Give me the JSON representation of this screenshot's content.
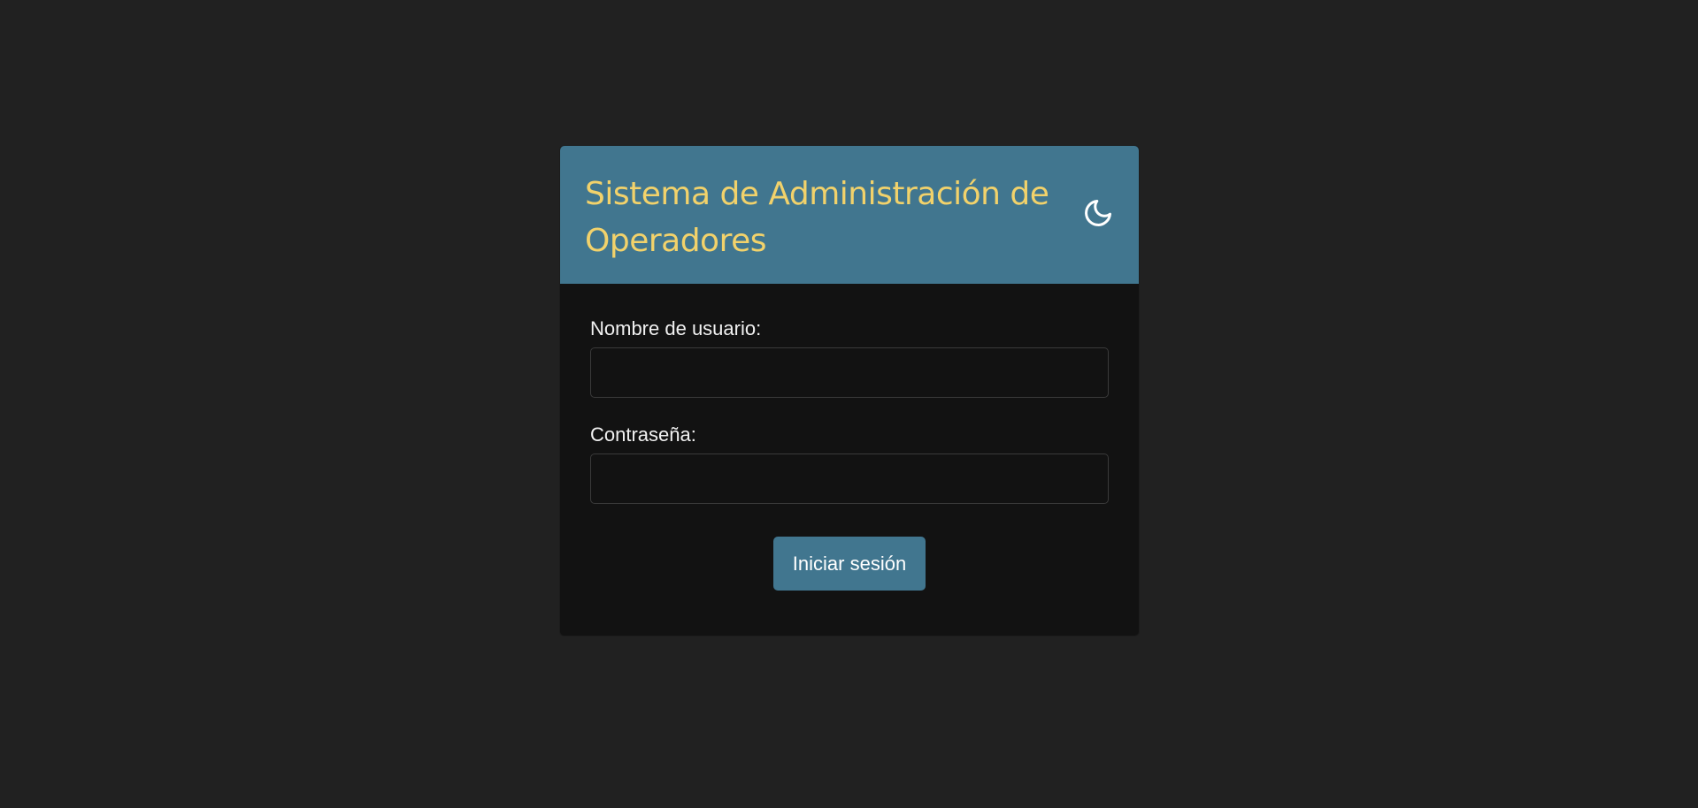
{
  "header": {
    "title": "Sistema de Administración de Operadores",
    "theme_icon": "moon-icon"
  },
  "form": {
    "username_label": "Nombre de usuario:",
    "username_value": "",
    "password_label": "Contraseña:",
    "password_value": "",
    "submit_label": "Iniciar sesión"
  },
  "colors": {
    "page_background": "#212121",
    "card_background": "#121212",
    "header_background": "#41768f",
    "title_color": "#f2d26b",
    "button_background": "#41768f",
    "button_text": "#ffffff"
  }
}
